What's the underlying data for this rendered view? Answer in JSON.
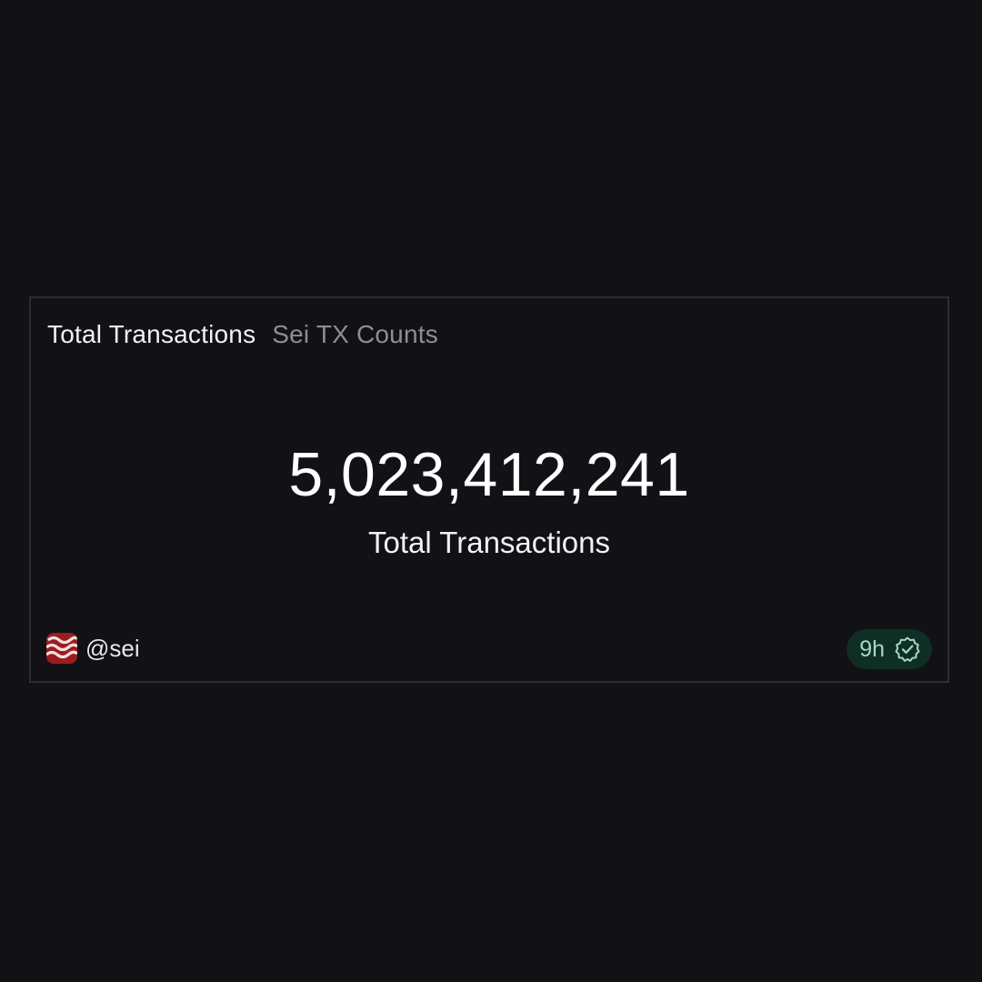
{
  "card": {
    "title": "Total Transactions",
    "subtitle": "Sei TX Counts",
    "value": "5,023,412,241",
    "value_label": "Total Transactions"
  },
  "footer": {
    "handle": "@sei",
    "logo_icon": "sei-logo-icon",
    "age": "9h",
    "verified_icon": "verified-badge-icon"
  },
  "colors": {
    "background": "#111116",
    "border": "#2d2d33",
    "badge_bg": "#0f2e24",
    "badge_text": "#a7d8c2",
    "logo_red": "#9b1c20"
  }
}
